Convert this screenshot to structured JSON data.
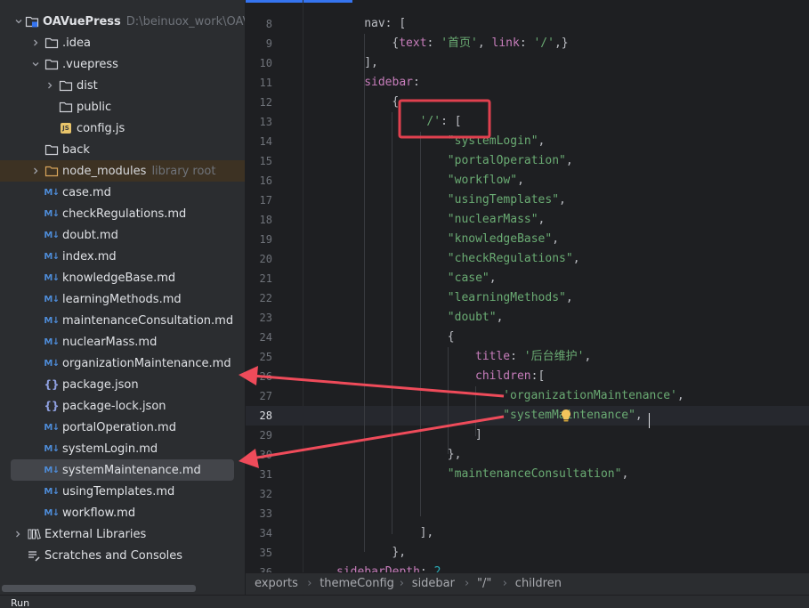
{
  "project": {
    "name": "OAVuePress",
    "path": "D:\\beinuox_work\\OAV",
    "rows": [
      {
        "label": "OAVuePress",
        "hint": "D:\\beinuox_work\\OAV",
        "icon": "project-folder-icon",
        "chev": "down"
      },
      {
        "label": ".idea",
        "icon": "folder-icon",
        "chev": "right"
      },
      {
        "label": ".vuepress",
        "icon": "folder-icon",
        "chev": "down"
      },
      {
        "label": "dist",
        "icon": "folder-icon",
        "chev": "right"
      },
      {
        "label": "public",
        "icon": "folder-icon",
        "chev": ""
      },
      {
        "label": "config.js",
        "icon": "js-file-icon",
        "chev": ""
      },
      {
        "label": "back",
        "icon": "folder-icon",
        "chev": ""
      },
      {
        "label": "node_modules",
        "hint": "library root",
        "icon": "library-folder-icon",
        "chev": "right"
      },
      {
        "label": "case.md",
        "icon": "markdown-file-icon",
        "chev": ""
      },
      {
        "label": "checkRegulations.md",
        "icon": "markdown-file-icon",
        "chev": ""
      },
      {
        "label": "doubt.md",
        "icon": "markdown-file-icon",
        "chev": ""
      },
      {
        "label": "index.md",
        "icon": "markdown-file-icon",
        "chev": ""
      },
      {
        "label": "knowledgeBase.md",
        "icon": "markdown-file-icon",
        "chev": ""
      },
      {
        "label": "learningMethods.md",
        "icon": "markdown-file-icon",
        "chev": ""
      },
      {
        "label": "maintenanceConsultation.md",
        "icon": "markdown-file-icon",
        "chev": ""
      },
      {
        "label": "nuclearMass.md",
        "icon": "markdown-file-icon",
        "chev": ""
      },
      {
        "label": "organizationMaintenance.md",
        "icon": "markdown-file-icon",
        "chev": ""
      },
      {
        "label": "package.json",
        "icon": "json-file-icon",
        "chev": ""
      },
      {
        "label": "package-lock.json",
        "icon": "json-file-icon",
        "chev": ""
      },
      {
        "label": "portalOperation.md",
        "icon": "markdown-file-icon",
        "chev": ""
      },
      {
        "label": "systemLogin.md",
        "icon": "markdown-file-icon",
        "chev": ""
      },
      {
        "label": "systemMaintenance.md",
        "icon": "markdown-file-icon",
        "chev": ""
      },
      {
        "label": "usingTemplates.md",
        "icon": "markdown-file-icon",
        "chev": ""
      },
      {
        "label": "workflow.md",
        "icon": "markdown-file-icon",
        "chev": ""
      },
      {
        "label": "External Libraries",
        "icon": "libraries-icon",
        "chev": "right"
      },
      {
        "label": "Scratches and Consoles",
        "icon": "scratches-icon",
        "chev": ""
      }
    ],
    "selected": "systemMaintenance.md"
  },
  "editor": {
    "current_line": "28",
    "lines": [
      {
        "n": "8",
        "t": [
          [
            "nav",
            ""
          ],
          [
            ": [",
            ""
          ]
        ]
      },
      {
        "n": "9",
        "t": [
          [
            "{",
            ""
          ],
          [
            "text",
            "k"
          ],
          [
            ": ",
            ""
          ],
          [
            "'首页'",
            "s"
          ],
          [
            ", ",
            ""
          ],
          [
            "link",
            "k"
          ],
          [
            ": ",
            ""
          ],
          [
            "'/'",
            "s"
          ],
          [
            ",}",
            ""
          ]
        ]
      },
      {
        "n": "10",
        "t": [
          [
            "],",
            ""
          ]
        ]
      },
      {
        "n": "11",
        "t": [
          [
            "sidebar",
            "k"
          ],
          [
            ":",
            ""
          ]
        ]
      },
      {
        "n": "12",
        "t": [
          [
            "{",
            ""
          ]
        ]
      },
      {
        "n": "13",
        "t": [
          [
            "'/'",
            "s"
          ],
          [
            ": [",
            ""
          ]
        ]
      },
      {
        "n": "14",
        "t": [
          [
            "\"systemLogin\"",
            "s"
          ],
          [
            ",",
            ""
          ]
        ]
      },
      {
        "n": "15",
        "t": [
          [
            "\"portalOperation\"",
            "s"
          ],
          [
            ",",
            ""
          ]
        ]
      },
      {
        "n": "16",
        "t": [
          [
            "\"workflow\"",
            "s"
          ],
          [
            ",",
            ""
          ]
        ]
      },
      {
        "n": "17",
        "t": [
          [
            "\"usingTemplates\"",
            "s"
          ],
          [
            ",",
            ""
          ]
        ]
      },
      {
        "n": "18",
        "t": [
          [
            "\"nuclearMass\"",
            "s"
          ],
          [
            ",",
            ""
          ]
        ]
      },
      {
        "n": "19",
        "t": [
          [
            "\"knowledgeBase\"",
            "s"
          ],
          [
            ",",
            ""
          ]
        ]
      },
      {
        "n": "20",
        "t": [
          [
            "\"checkRegulations\"",
            "s"
          ],
          [
            ",",
            ""
          ]
        ]
      },
      {
        "n": "21",
        "t": [
          [
            "\"case\"",
            "s"
          ],
          [
            ",",
            ""
          ]
        ]
      },
      {
        "n": "22",
        "t": [
          [
            "\"learningMethods\"",
            "s"
          ],
          [
            ",",
            ""
          ]
        ]
      },
      {
        "n": "23",
        "t": [
          [
            "\"doubt\"",
            "s"
          ],
          [
            ",",
            ""
          ]
        ]
      },
      {
        "n": "24",
        "t": [
          [
            "{",
            ""
          ]
        ]
      },
      {
        "n": "25",
        "t": [
          [
            "title",
            "k"
          ],
          [
            ": ",
            ""
          ],
          [
            "'后台维护'",
            "s"
          ],
          [
            ",",
            ""
          ]
        ]
      },
      {
        "n": "26",
        "t": [
          [
            "children",
            "k"
          ],
          [
            ":[",
            ""
          ]
        ]
      },
      {
        "n": "27",
        "t": [
          [
            "'organizationMaintenance'",
            "s"
          ],
          [
            ",",
            ""
          ]
        ]
      },
      {
        "n": "28",
        "t": [
          [
            "\"systemMaintenance\"",
            "s"
          ],
          [
            ",",
            ""
          ]
        ]
      },
      {
        "n": "29",
        "t": [
          [
            "]",
            ""
          ]
        ]
      },
      {
        "n": "30",
        "t": [
          [
            "},",
            ""
          ]
        ]
      },
      {
        "n": "31",
        "t": [
          [
            "\"maintenanceConsultation\"",
            "s"
          ],
          [
            ",",
            ""
          ]
        ]
      },
      {
        "n": "32",
        "t": []
      },
      {
        "n": "33",
        "t": []
      },
      {
        "n": "34",
        "t": [
          [
            "],",
            ""
          ]
        ]
      },
      {
        "n": "35",
        "t": [
          [
            "},",
            ""
          ]
        ]
      }
    ],
    "partial_bottom": {
      "n": "36",
      "t": [
        [
          "sidebarDepth",
          "k"
        ],
        [
          ": ",
          ""
        ],
        [
          "2",
          "n"
        ]
      ]
    }
  },
  "breadcrumbs": [
    "exports",
    "themeConfig",
    "sidebar",
    "\"/\"",
    "children"
  ],
  "bottom_label": "Run",
  "colors": {
    "highlight_box": "#e0404f",
    "arrow": "#ef4b5a",
    "keyword": "#c77dbb",
    "string": "#6aab73",
    "number": "#2aacb8"
  }
}
